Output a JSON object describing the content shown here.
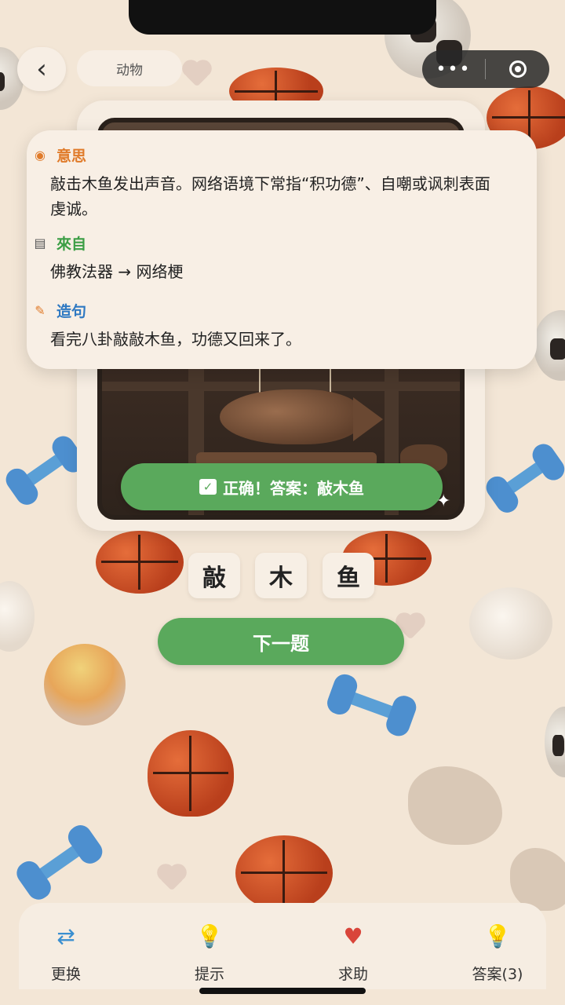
{
  "header": {
    "back_icon": "chevron-left-icon",
    "category": "动物",
    "menu_icon": "more-dots-icon",
    "close_icon": "target-icon"
  },
  "info": {
    "meaning": {
      "icon": "info-icon",
      "title": "意思",
      "text": "敲击木鱼发出声音。网络语境下常指“积功德”、自嘲或讽刺表面虔诚。"
    },
    "origin": {
      "icon": "scroll-icon",
      "title": "來自",
      "text": "佛教法器 → 网络梗"
    },
    "example": {
      "icon": "pencil-icon",
      "title": "造句",
      "text": "看完八卦敲敲木鱼，功德又回来了。"
    }
  },
  "result": {
    "icon": "check-icon",
    "text": "正确！答案：敲木鱼"
  },
  "answer_tiles": [
    "敲",
    "木",
    "鱼"
  ],
  "next_button": "下一题",
  "bottom_nav": [
    {
      "icon": "swap-icon",
      "label": "更换"
    },
    {
      "icon": "lightbulb-icon",
      "label": "提示"
    },
    {
      "icon": "help-hand-icon",
      "label": "求助"
    },
    {
      "icon": "answer-bulb-icon",
      "label": "答案(3)"
    }
  ],
  "colors": {
    "green": "#5aa95c",
    "meaning": "#e07b2a",
    "origin": "#3c9e45",
    "example": "#2f79c2"
  }
}
